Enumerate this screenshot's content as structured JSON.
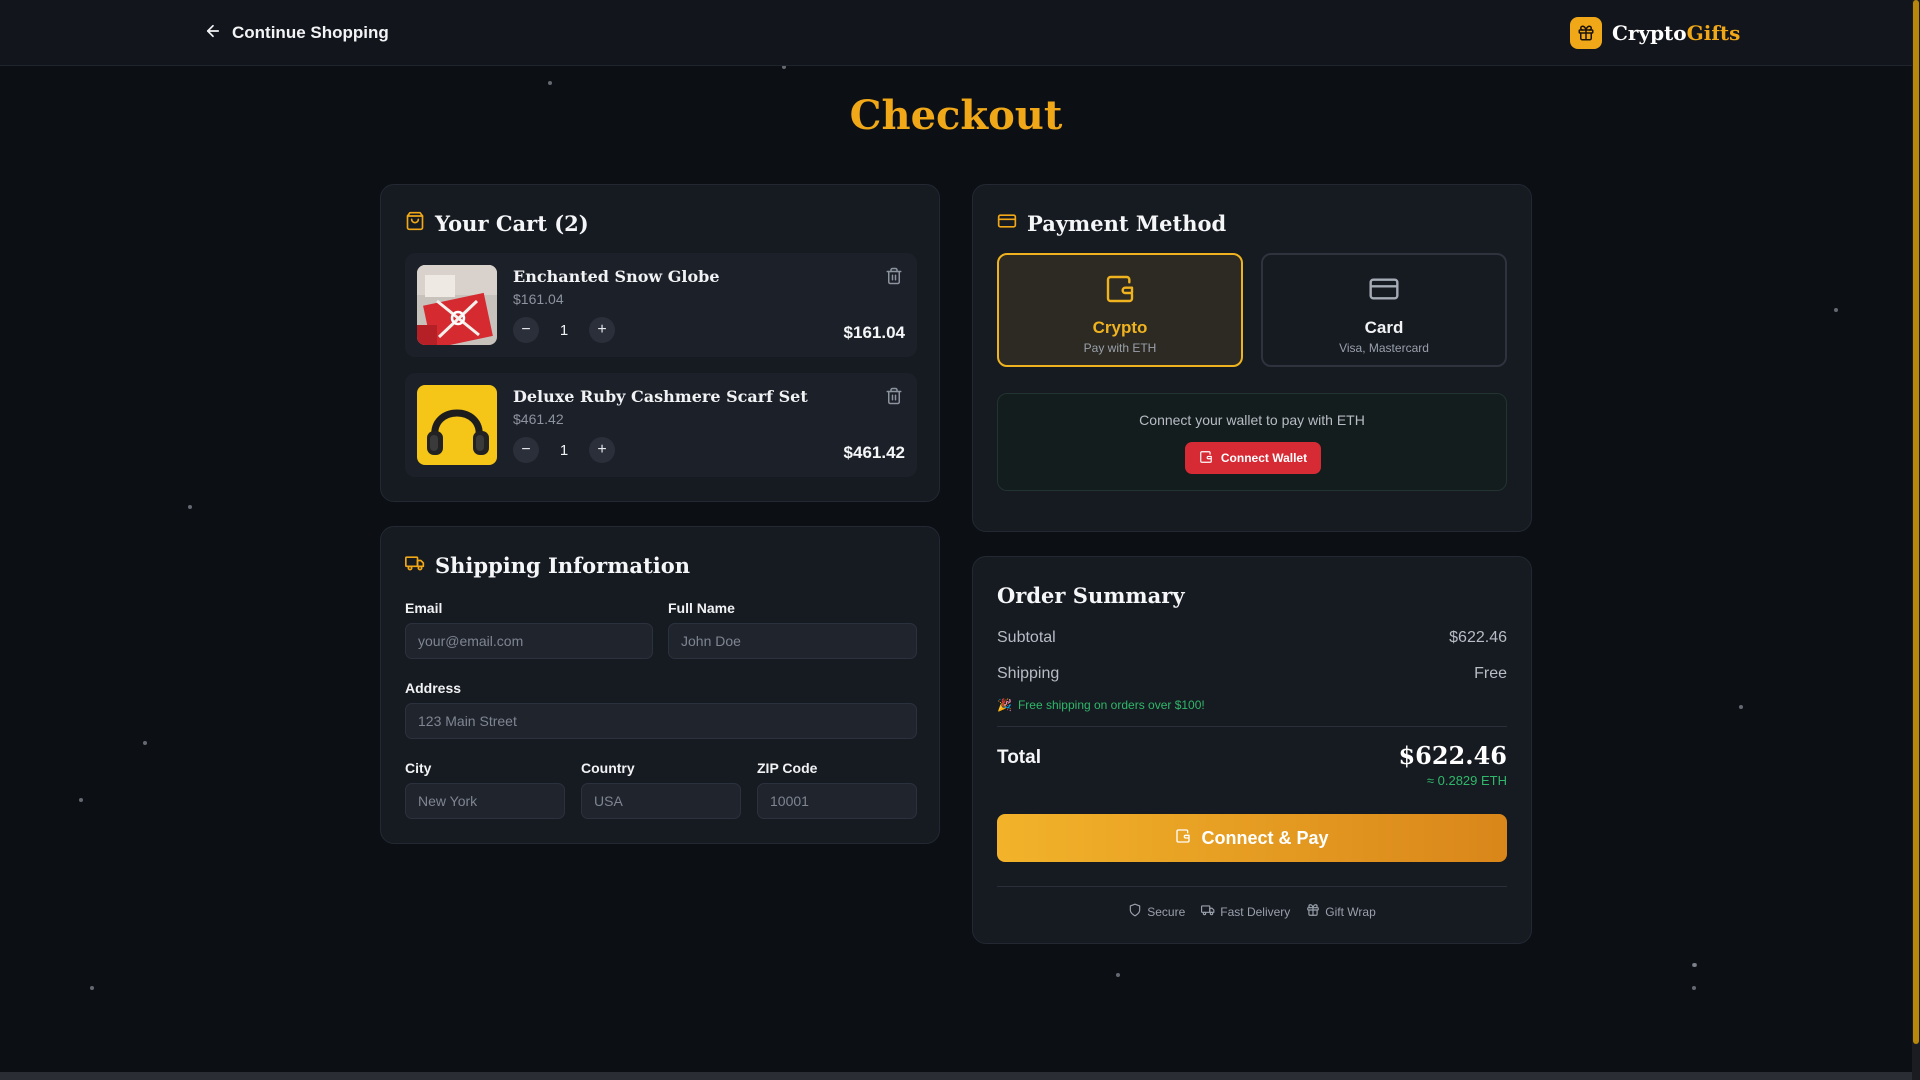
{
  "header": {
    "back_label": "Continue Shopping",
    "brand_main": "Crypto",
    "brand_accent": "Gifts"
  },
  "page": {
    "title": "Checkout"
  },
  "cart": {
    "title": "Your Cart (2)",
    "items": [
      {
        "name": "Enchanted Snow Globe",
        "unit_price": "$161.04",
        "quantity": "1",
        "total": "$161.04"
      },
      {
        "name": "Deluxe Ruby Cashmere Scarf Set",
        "unit_price": "$461.42",
        "quantity": "1",
        "total": "$461.42"
      }
    ],
    "decrement_symbol": "−",
    "increment_symbol": "+"
  },
  "shipping": {
    "title": "Shipping Information",
    "email": {
      "label": "Email",
      "placeholder": "your@email.com"
    },
    "full_name": {
      "label": "Full Name",
      "placeholder": "John Doe"
    },
    "address": {
      "label": "Address",
      "placeholder": "123 Main Street"
    },
    "city": {
      "label": "City",
      "placeholder": "New York"
    },
    "country": {
      "label": "Country",
      "placeholder": "USA"
    },
    "zip": {
      "label": "ZIP Code",
      "placeholder": "10001"
    }
  },
  "payment": {
    "title": "Payment Method",
    "options": [
      {
        "label": "Crypto",
        "sub": "Pay with ETH",
        "selected": true
      },
      {
        "label": "Card",
        "sub": "Visa, Mastercard",
        "selected": false
      }
    ],
    "wallet_prompt": "Connect your wallet to pay with ETH",
    "wallet_button": "Connect Wallet"
  },
  "summary": {
    "title": "Order Summary",
    "subtotal_label": "Subtotal",
    "subtotal_value": "$622.46",
    "shipping_label": "Shipping",
    "shipping_value": "Free",
    "free_note_icon": "🎉",
    "free_note": "Free shipping on orders over $100!",
    "total_label": "Total",
    "total_value": "$622.46",
    "total_eth": "≈ 0.2829 ETH",
    "pay_button": "Connect & Pay",
    "features": [
      "Secure",
      "Fast Delivery",
      "Gift Wrap"
    ]
  },
  "colors": {
    "accent": "#f0a818",
    "danger": "#d62b34",
    "success": "#2fb86a",
    "background": "#0c0f14"
  }
}
